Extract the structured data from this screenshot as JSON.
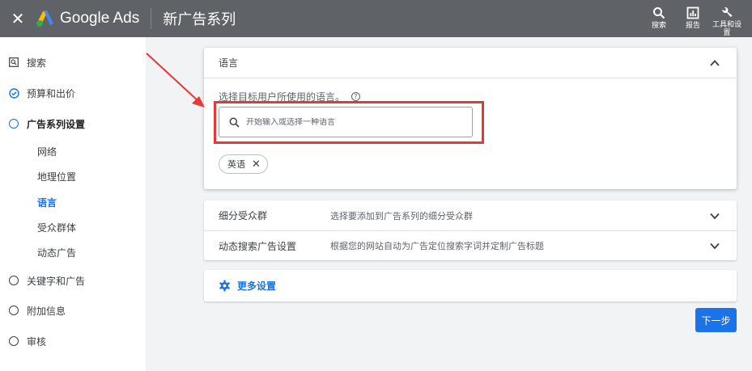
{
  "topbar": {
    "close_icon": "close-icon",
    "brand": "Google Ads",
    "page_title": "新广告系列",
    "actions": [
      {
        "label": "搜索",
        "icon": "search-icon"
      },
      {
        "label": "报告",
        "icon": "report-icon"
      },
      {
        "label": "工具和设置",
        "icon": "wrench-icon"
      }
    ]
  },
  "sidebar": {
    "items": [
      {
        "label": "搜索",
        "icon": "search-icon"
      },
      {
        "label": "预算和出价",
        "icon": "check-circle-icon"
      },
      {
        "label": "广告系列设置",
        "icon": "circle-icon"
      },
      {
        "label": "关键字和广告",
        "icon": "circle-icon"
      },
      {
        "label": "附加信息",
        "icon": "circle-icon"
      },
      {
        "label": "审核",
        "icon": "circle-icon"
      }
    ],
    "sub_items": [
      {
        "label": "网络"
      },
      {
        "label": "地理位置"
      },
      {
        "label": "语言",
        "active": true
      },
      {
        "label": "受众群体"
      },
      {
        "label": "动态广告"
      }
    ]
  },
  "language_panel": {
    "title": "语言",
    "prompt": "选择目标用户所使用的语言。",
    "search_placeholder": "开始输入或选择一种语言",
    "selected_chip": "英语"
  },
  "collapsed_rows": [
    {
      "name": "细分受众群",
      "desc": "选择要添加到广告系列的细分受众群"
    },
    {
      "name": "动态搜索广告设置",
      "desc": "根据您的网站自动为广告定位搜索字词并定制广告标题"
    }
  ],
  "more_settings": {
    "label": "更多设置",
    "icon": "gear-icon"
  },
  "next_button": {
    "label": "下一步"
  },
  "colors": {
    "topbar": "#5f6368",
    "accent": "#1a73e8",
    "highlight": "#e53935"
  }
}
